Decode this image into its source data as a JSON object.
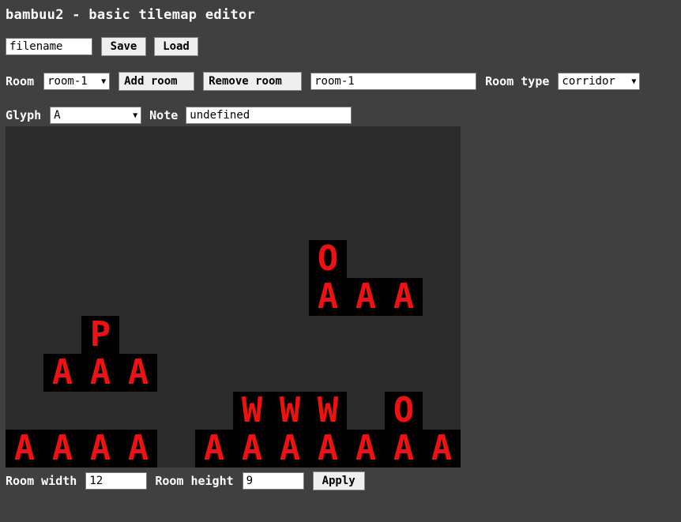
{
  "app": {
    "title": "bambuu2 - basic tilemap editor"
  },
  "file": {
    "filename_value": "filename",
    "save_label": "Save",
    "load_label": "Load"
  },
  "room": {
    "label": "Room",
    "selected": "room-1",
    "add_label": "Add room",
    "remove_label": "Remove room",
    "name_value": "room-1",
    "type_label": "Room type",
    "type_selected": "corridor"
  },
  "glyph": {
    "label": "Glyph",
    "selected": "A",
    "note_label": "Note",
    "note_value": "undefined"
  },
  "size": {
    "width_label": "Room width",
    "width_value": "12",
    "height_label": "Room height",
    "height_value": "9",
    "apply_label": "Apply"
  },
  "tilemap": {
    "columns": 12,
    "rows": 9,
    "glyph_color": "#ee1111",
    "tiles": [
      {
        "row": 3,
        "col": 8,
        "glyph": "O"
      },
      {
        "row": 4,
        "col": 8,
        "glyph": "A"
      },
      {
        "row": 4,
        "col": 9,
        "glyph": "A"
      },
      {
        "row": 4,
        "col": 10,
        "glyph": "A"
      },
      {
        "row": 5,
        "col": 2,
        "glyph": "P"
      },
      {
        "row": 6,
        "col": 1,
        "glyph": "A"
      },
      {
        "row": 6,
        "col": 2,
        "glyph": "A"
      },
      {
        "row": 6,
        "col": 3,
        "glyph": "A"
      },
      {
        "row": 7,
        "col": 6,
        "glyph": "W"
      },
      {
        "row": 7,
        "col": 7,
        "glyph": "W"
      },
      {
        "row": 7,
        "col": 8,
        "glyph": "W"
      },
      {
        "row": 7,
        "col": 10,
        "glyph": "O"
      },
      {
        "row": 8,
        "col": 0,
        "glyph": "A"
      },
      {
        "row": 8,
        "col": 1,
        "glyph": "A"
      },
      {
        "row": 8,
        "col": 2,
        "glyph": "A"
      },
      {
        "row": 8,
        "col": 3,
        "glyph": "A"
      },
      {
        "row": 8,
        "col": 5,
        "glyph": "A"
      },
      {
        "row": 8,
        "col": 6,
        "glyph": "A"
      },
      {
        "row": 8,
        "col": 7,
        "glyph": "A"
      },
      {
        "row": 8,
        "col": 8,
        "glyph": "A"
      },
      {
        "row": 8,
        "col": 9,
        "glyph": "A"
      },
      {
        "row": 8,
        "col": 10,
        "glyph": "A"
      },
      {
        "row": 8,
        "col": 11,
        "glyph": "A"
      }
    ]
  }
}
